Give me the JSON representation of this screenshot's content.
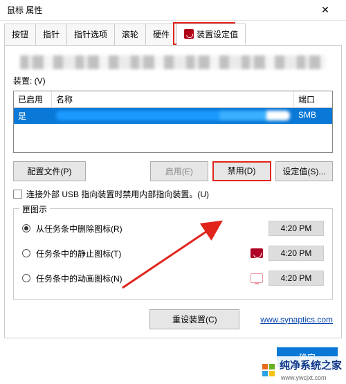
{
  "window": {
    "title": "鼠标 属性",
    "close": "✕"
  },
  "tabs": {
    "items": [
      {
        "label": "按钮"
      },
      {
        "label": "指针"
      },
      {
        "label": "指针选项"
      },
      {
        "label": "滚轮"
      },
      {
        "label": "硬件"
      },
      {
        "label": "装置设定值",
        "active": true,
        "icon": "synaptics-icon"
      }
    ]
  },
  "devices": {
    "label": "装置: (V)",
    "columns": {
      "enabled": "已启用",
      "name": "名称",
      "port": "端口"
    },
    "row": {
      "enabled": "是",
      "port": "SMB"
    }
  },
  "buttons": {
    "profiles": "配置文件(P)",
    "enable": "启用(E)",
    "disable": "禁用(D)",
    "settings": "设定值(S)...",
    "reset": "重设装置(C)",
    "ok": "确定"
  },
  "checkbox": {
    "label": "连接外部 USB 指向装置时禁用内部指向装置。(U)"
  },
  "tray": {
    "legend": "匣图示",
    "opt1": "从任务条中删除图标(R)",
    "opt2": "任务条中的静止图标(T)",
    "opt3": "任务条中的动画图标(N)",
    "time": "4:20 PM"
  },
  "link": {
    "text": "www.synaptics.com"
  },
  "watermark": {
    "brand": "纯净系统之家",
    "url": "www.ywcjxt.com"
  },
  "colors": {
    "accent": "#0a78d6",
    "highlight": "#e1251b",
    "logo": [
      "#e86c1a",
      "#67b021",
      "#2aa3e0",
      "#f7c30f"
    ]
  }
}
